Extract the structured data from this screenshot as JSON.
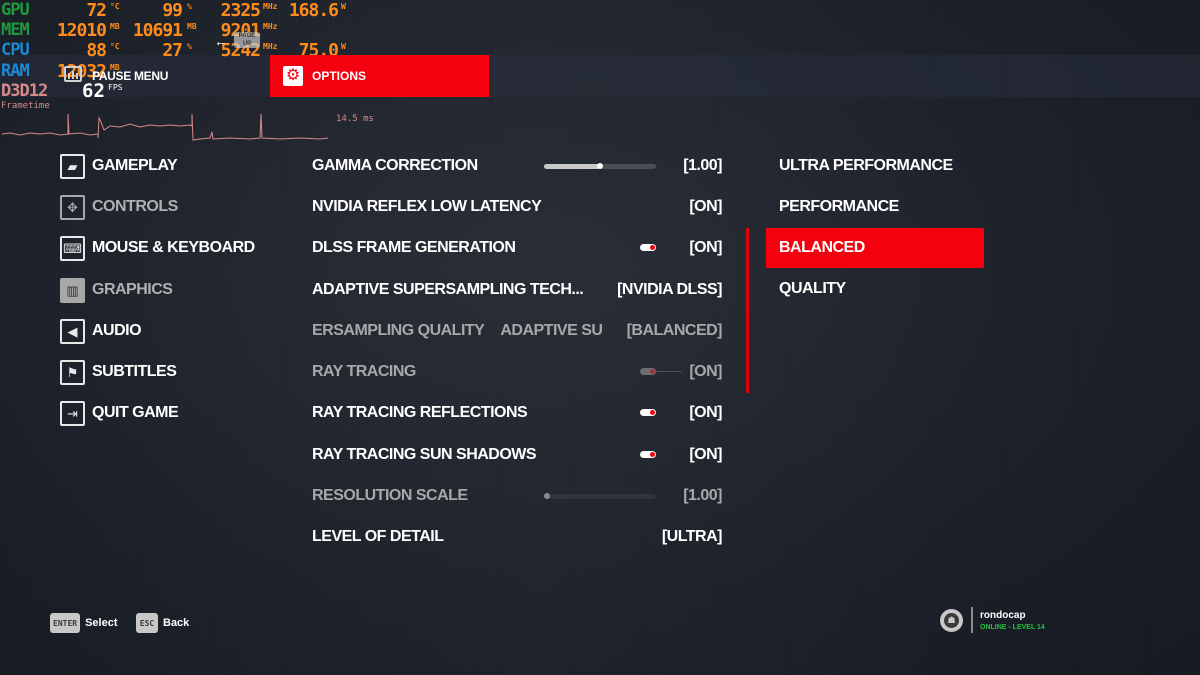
{
  "overlay": {
    "rows": [
      {
        "label": "GPU",
        "values": [
          {
            "v": "72",
            "u": "°C"
          },
          {
            "v": "99",
            "u": "%"
          },
          {
            "v": "2325",
            "u": "MHz"
          },
          {
            "v": "168.6",
            "u": "W"
          }
        ]
      },
      {
        "label": "MEM",
        "values": [
          {
            "v": "12010",
            "u": "MB"
          },
          {
            "v": "10691",
            "u": "MB"
          },
          {
            "v": "9201",
            "u": "MHz"
          }
        ]
      },
      {
        "label": "CPU",
        "values": [
          {
            "v": "88",
            "u": "°C"
          },
          {
            "v": "27",
            "u": "%"
          },
          {
            "v": "5242",
            "u": "MHz"
          },
          {
            "v": "75.0",
            "u": "W"
          }
        ]
      },
      {
        "label": "RAM",
        "values": [
          {
            "v": "12032",
            "u": "MB"
          }
        ]
      },
      {
        "label": "D3D12",
        "values": []
      }
    ],
    "fps_value": "62",
    "fps_unit": "FPS",
    "frametime_label": "Frametime",
    "frametime_value": "14.5 ms"
  },
  "header": {
    "pause_menu": "PAUSE MENU",
    "page_key": "PAGE UP",
    "back_arrow": "←",
    "options_tab": "OPTIONS",
    "options_icon": "⚙"
  },
  "sidebar": {
    "items": [
      {
        "label": "GAMEPLAY",
        "icon": "▰",
        "dim": false
      },
      {
        "label": "CONTROLS",
        "icon": "✥",
        "dim": true
      },
      {
        "label": "MOUSE & KEYBOARD",
        "icon": "⌨",
        "dim": false
      },
      {
        "label": "GRAPHICS",
        "icon": "▥",
        "dim": true
      },
      {
        "label": "AUDIO",
        "icon": "◀",
        "dim": false
      },
      {
        "label": "SUBTITLES",
        "icon": "⚑",
        "dim": false
      },
      {
        "label": "QUIT GAME",
        "icon": "⇥",
        "dim": false
      }
    ]
  },
  "settings": {
    "rows": [
      {
        "label": "GAMMA CORRECTION",
        "value": "[1.00]",
        "control": "slider",
        "slider_fraction": 0.5
      },
      {
        "label": "NVIDIA REFLEX LOW LATENCY",
        "value": "[ON]",
        "control": "none"
      },
      {
        "label": "DLSS FRAME GENERATION",
        "value": "[ON]",
        "control": "toggle"
      },
      {
        "label": "ADAPTIVE SUPERSAMPLING TECH...",
        "value": "[NVIDIA DLSS]",
        "control": "none"
      },
      {
        "label": "ERSAMPLING QUALITY",
        "label_marquee_next": "ADAPTIVE SU",
        "value": "[BALANCED]",
        "control": "none"
      },
      {
        "label": "RAY TRACING",
        "value": "[ON]",
        "control": "toggle",
        "dim": true
      },
      {
        "label": "RAY TRACING REFLECTIONS",
        "value": "[ON]",
        "control": "toggle"
      },
      {
        "label": "RAY TRACING SUN SHADOWS",
        "value": "[ON]",
        "control": "toggle"
      },
      {
        "label": "RESOLUTION SCALE",
        "value": "[1.00]",
        "control": "slider",
        "slider_fraction": 0.0,
        "dim": true
      },
      {
        "label": "LEVEL OF DETAIL",
        "value": "[ULTRA]",
        "control": "none"
      }
    ]
  },
  "dropdown": {
    "options": [
      "ULTRA PERFORMANCE",
      "PERFORMANCE",
      "BALANCED",
      "QUALITY"
    ],
    "selected": "BALANCED"
  },
  "footer": {
    "select_key": "ENTER",
    "select_label": "Select",
    "back_key": "ESC",
    "back_label": "Back"
  },
  "profile": {
    "username": "rondocap",
    "status": "ONLINE - LEVEL 14"
  },
  "colors": {
    "accent": "#f5000f",
    "online": "#22c23a",
    "osd_value": "#ff8c1a"
  }
}
